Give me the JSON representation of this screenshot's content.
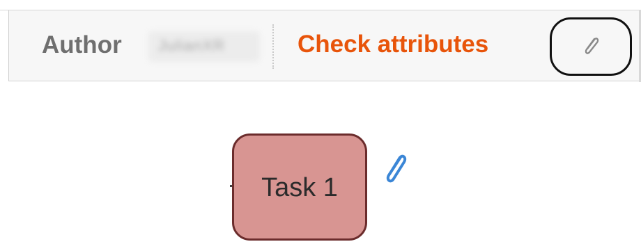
{
  "toolbar": {
    "author_label": "Author",
    "author_value": "JulianXR",
    "check_attributes_label": "Check attributes",
    "attachment_icon": "paperclip-icon"
  },
  "canvas": {
    "task": {
      "label": "Task 1",
      "fill_color": "#d89592",
      "border_color": "#6b2c2c",
      "attachment_icon": "paperclip-icon",
      "attachment_icon_color": "#3b86d6"
    }
  },
  "colors": {
    "accent": "#e8540a",
    "label_gray": "#6f6f6f"
  }
}
